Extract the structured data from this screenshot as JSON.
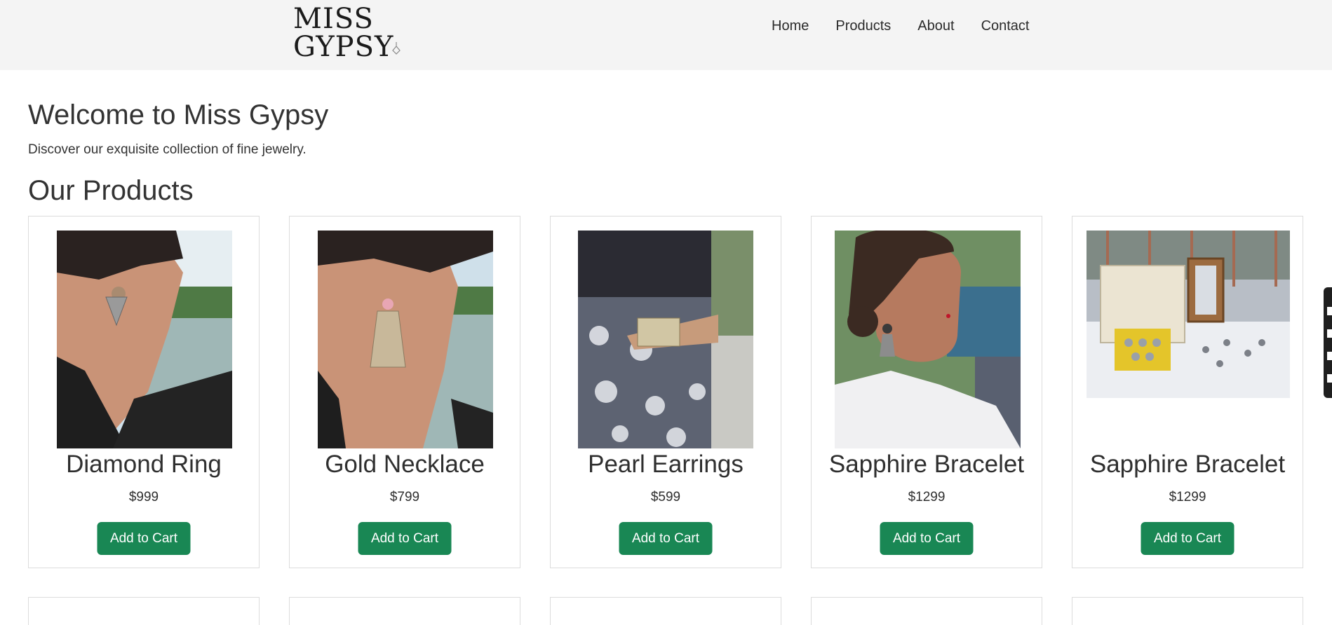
{
  "header": {
    "logo_text": "MISS GYPSY",
    "nav": [
      "Home",
      "Products",
      "About",
      "Contact"
    ]
  },
  "main": {
    "welcome_title": "Welcome to Miss Gypsy",
    "welcome_subtitle": "Discover our exquisite collection of fine jewelry.",
    "products_title": "Our Products"
  },
  "products": [
    {
      "name": "Diamond Ring",
      "price": "$999",
      "button": "Add to Cart"
    },
    {
      "name": "Gold Necklace",
      "price": "$799",
      "button": "Add to Cart"
    },
    {
      "name": "Pearl Earrings",
      "price": "$599",
      "button": "Add to Cart"
    },
    {
      "name": "Sapphire Bracelet",
      "price": "$1299",
      "button": "Add to Cart"
    },
    {
      "name": "Sapphire Bracelet",
      "price": "$1299",
      "button": "Add to Cart"
    }
  ],
  "colors": {
    "header_bg": "#f4f4f4",
    "button_bg": "#198754",
    "button_text": "#ffffff",
    "card_border": "#dcdcdc"
  }
}
